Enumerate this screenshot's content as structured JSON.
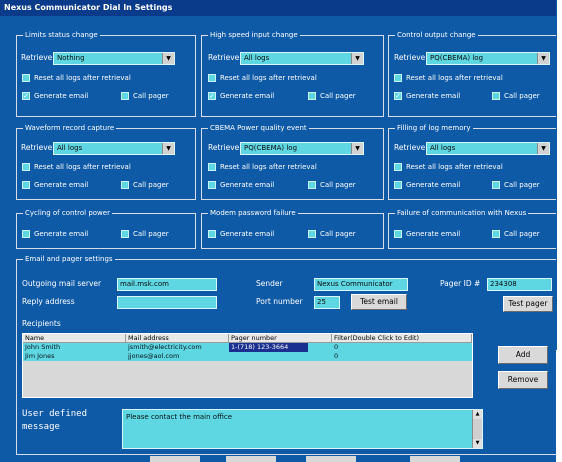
{
  "window": {
    "title": "Nexus Communicator Dial In Settings"
  },
  "colors": {
    "background": "#0e5aa6",
    "field": "#5fd7e2",
    "title_bar": "#0a3a8a",
    "selection": "#1a2f8f"
  },
  "panels": {
    "limits": {
      "title": "Limits status change",
      "retrieve_label": "Retrieve",
      "retrieve_value": "Nothing",
      "reset_label": "Reset all logs after retrieval",
      "reset_checked": false,
      "email_label": "Generate email",
      "email_checked": true,
      "pager_label": "Call pager",
      "pager_checked": false
    },
    "highspeed": {
      "title": "High speed input change",
      "retrieve_label": "Retrieve",
      "retrieve_value": "All logs",
      "reset_label": "Reset all logs after retrieval",
      "reset_checked": false,
      "email_label": "Generate email",
      "email_checked": true,
      "pager_label": "Call pager",
      "pager_checked": false
    },
    "control": {
      "title": "Control output change",
      "retrieve_label": "Retrieve",
      "retrieve_value": "PQ(CBEMA) log",
      "reset_label": "Reset all logs after retrieval",
      "reset_checked": false,
      "email_label": "Generate email",
      "email_checked": true,
      "pager_label": "Call pager",
      "pager_checked": false
    },
    "waveform": {
      "title": "Waveform record capture",
      "retrieve_label": "Retrieve",
      "retrieve_value": "All logs",
      "reset_label": "Reset all logs after retrieval",
      "reset_checked": false,
      "email_label": "Generate email",
      "email_checked": false,
      "pager_label": "Call pager",
      "pager_checked": false
    },
    "cbema": {
      "title": "CBEMA Power quality event",
      "retrieve_label": "Retrieve",
      "retrieve_value": "PQ(CBEMA) log",
      "reset_label": "Reset all logs after retrieval",
      "reset_checked": false,
      "email_label": "Generate email",
      "email_checked": false,
      "pager_label": "Call pager",
      "pager_checked": false
    },
    "filling": {
      "title": "Filling of log memory",
      "retrieve_label": "Retrieve",
      "retrieve_value": "All logs",
      "reset_label": "Reset all logs after retrieval",
      "reset_checked": false,
      "email_label": "Generate email",
      "email_checked": false,
      "pager_label": "Call pager",
      "pager_checked": false
    },
    "cycling": {
      "title": "Cycling of control power",
      "email_label": "Generate email",
      "email_checked": false,
      "pager_label": "Call pager",
      "pager_checked": false
    },
    "modem": {
      "title": "Modem password failure",
      "email_label": "Generate email",
      "email_checked": false,
      "pager_label": "Call pager",
      "pager_checked": false
    },
    "failure": {
      "title": "Failure of communication with Nexus",
      "email_label": "Generate email",
      "email_checked": false,
      "pager_label": "Call pager",
      "pager_checked": false
    }
  },
  "email": {
    "title": "Email and pager settings",
    "server_label": "Outgoing mail server",
    "server_value": "mail.msk.com",
    "reply_label": "Reply address",
    "reply_value": "",
    "sender_label": "Sender",
    "sender_value": "Nexus Communicator",
    "port_label": "Port number",
    "port_value": "25",
    "test_email_label": "Test email",
    "pager_id_label": "Pager ID #",
    "pager_id_value": "234308",
    "test_pager_label": "Test pager",
    "recipients_label": "Recipients",
    "columns": [
      "Name",
      "Mail address",
      "Pager number",
      "Filter(Double Click to Edit)"
    ],
    "rows": [
      {
        "name": "John Smith",
        "mail": "jsmith@electricity.com",
        "pager": "1-(718) 123-3664",
        "filter": "0"
      },
      {
        "name": "Jim Jones",
        "mail": "jjones@aol.com",
        "pager": "",
        "filter": "0"
      }
    ],
    "add_label": "Add",
    "remove_label": "Remove",
    "message_label_1": "User defined",
    "message_label_2": "message",
    "message_value": "Please contact the main office"
  }
}
